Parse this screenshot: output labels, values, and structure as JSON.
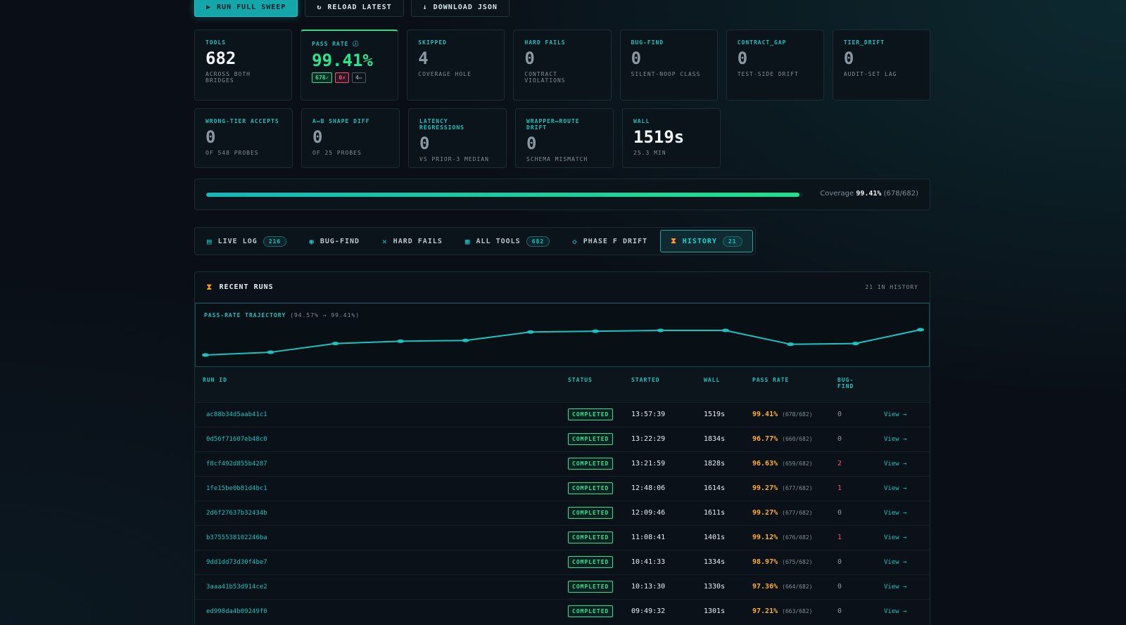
{
  "toolbar": {
    "run_label": "RUN FULL SWEEP",
    "reload_label": "RELOAD LATEST",
    "download_label": "DOWNLOAD JSON"
  },
  "stats_row1": [
    {
      "label": "TOOLS",
      "value": "682",
      "sub": "ACROSS BOTH BRIDGES"
    },
    {
      "label": "PASS RATE ⓘ",
      "value": "99.41%",
      "badges": [
        "678✓",
        "0✗",
        "4–"
      ]
    },
    {
      "label": "SKIPPED",
      "value": "4",
      "sub": "COVERAGE HOLE"
    },
    {
      "label": "HARD FAILS",
      "value": "0",
      "sub": "CONTRACT VIOLATIONS"
    },
    {
      "label": "BUG-FIND",
      "value": "0",
      "sub": "SILENT-NOOP CLASS"
    },
    {
      "label": "CONTRACT_GAP",
      "value": "0",
      "sub": "TEST-SIDE DRIFT"
    },
    {
      "label": "TIER_DRIFT",
      "value": "0",
      "sub": "AUDIT-SET LAG"
    }
  ],
  "stats_row2": [
    {
      "label": "WRONG-TIER ACCEPTS",
      "value": "0",
      "sub": "OF 548 PROBES"
    },
    {
      "label": "A↔B SHAPE DIFF",
      "value": "0",
      "sub": "OF 25 PROBES"
    },
    {
      "label": "LATENCY REGRESSIONS",
      "value": "0",
      "sub": "VS PRIOR-3 MEDIAN"
    },
    {
      "label": "WRAPPER↔ROUTE DRIFT",
      "value": "0",
      "sub": "SCHEMA MISMATCH"
    },
    {
      "label": "WALL",
      "value": "1519s",
      "sub": "25.3 MIN"
    }
  ],
  "coverage": {
    "label": "Coverage",
    "percent": "99.41%",
    "detail": "(678/682)",
    "fraction": 0.9941
  },
  "tabs": [
    {
      "icon": "list-icon",
      "glyph": "▤",
      "label": "LIVE LOG",
      "count": "216"
    },
    {
      "icon": "circle-icon",
      "glyph": "◉",
      "label": "BUG-FIND",
      "count": ""
    },
    {
      "icon": "x-icon",
      "glyph": "✕",
      "label": "HARD FAILS",
      "count": ""
    },
    {
      "icon": "doc-icon",
      "glyph": "▦",
      "label": "ALL TOOLS",
      "count": "682"
    },
    {
      "icon": "diamond-icon",
      "glyph": "◇",
      "label": "PHASE F DRIFT",
      "count": ""
    },
    {
      "icon": "hourglass-icon",
      "glyph": "⧗",
      "label": "HISTORY",
      "count": "21",
      "active": true
    }
  ],
  "panel": {
    "icon": "hourglass-icon",
    "title": "RECENT RUNS",
    "count": "21 IN HISTORY",
    "trajectory_label": "PASS-RATE TRAJECTORY",
    "trajectory_range": "(94.57% → 99.41%)"
  },
  "chart_data": {
    "type": "line",
    "title": "PASS-RATE TRAJECTORY",
    "values": [
      94.57,
      95.1,
      96.77,
      97.21,
      97.36,
      98.97,
      99.12,
      99.27,
      99.27,
      96.63,
      96.77,
      99.41
    ],
    "ylim": [
      94.57,
      99.41
    ],
    "accent": "#19c4c0"
  },
  "table": {
    "headers": [
      "RUN ID",
      "STATUS",
      "STARTED",
      "WALL",
      "PASS RATE",
      "BUG-FIND",
      ""
    ],
    "rows": [
      {
        "id": "ac88b34d5aab41c1",
        "status": "COMPLETED",
        "started": "13:57:39",
        "wall": "1519s",
        "rate": "99.41%",
        "frac": "(678/682)",
        "bug": "0",
        "view": "View →"
      },
      {
        "id": "0d56f71607eb48c0",
        "status": "COMPLETED",
        "started": "13:22:29",
        "wall": "1834s",
        "rate": "96.77%",
        "frac": "(660/682)",
        "bug": "0",
        "view": "View →"
      },
      {
        "id": "f8cf492d855b4287",
        "status": "COMPLETED",
        "started": "13:21:59",
        "wall": "1828s",
        "rate": "96.63%",
        "frac": "(659/682)",
        "bug": "2",
        "view": "View →"
      },
      {
        "id": "1fe15be0b81d4bc1",
        "status": "COMPLETED",
        "started": "12:48:06",
        "wall": "1614s",
        "rate": "99.27%",
        "frac": "(677/682)",
        "bug": "1",
        "view": "View →"
      },
      {
        "id": "2d6f27637b32434b",
        "status": "COMPLETED",
        "started": "12:09:46",
        "wall": "1611s",
        "rate": "99.27%",
        "frac": "(677/682)",
        "bug": "0",
        "view": "View →"
      },
      {
        "id": "b3755538102246ba",
        "status": "COMPLETED",
        "started": "11:08:41",
        "wall": "1401s",
        "rate": "99.12%",
        "frac": "(676/682)",
        "bug": "1",
        "view": "View →"
      },
      {
        "id": "9dd1dd73d30f4be7",
        "status": "COMPLETED",
        "started": "10:41:33",
        "wall": "1334s",
        "rate": "98.97%",
        "frac": "(675/682)",
        "bug": "0",
        "view": "View →"
      },
      {
        "id": "3aaa41b53d914ce2",
        "status": "COMPLETED",
        "started": "10:13:30",
        "wall": "1330s",
        "rate": "97.36%",
        "frac": "(664/682)",
        "bug": "0",
        "view": "View →"
      },
      {
        "id": "ed998da4b09249f0",
        "status": "COMPLETED",
        "started": "09:49:32",
        "wall": "1301s",
        "rate": "97.21%",
        "frac": "(663/682)",
        "bug": "0",
        "view": "View →"
      }
    ]
  }
}
